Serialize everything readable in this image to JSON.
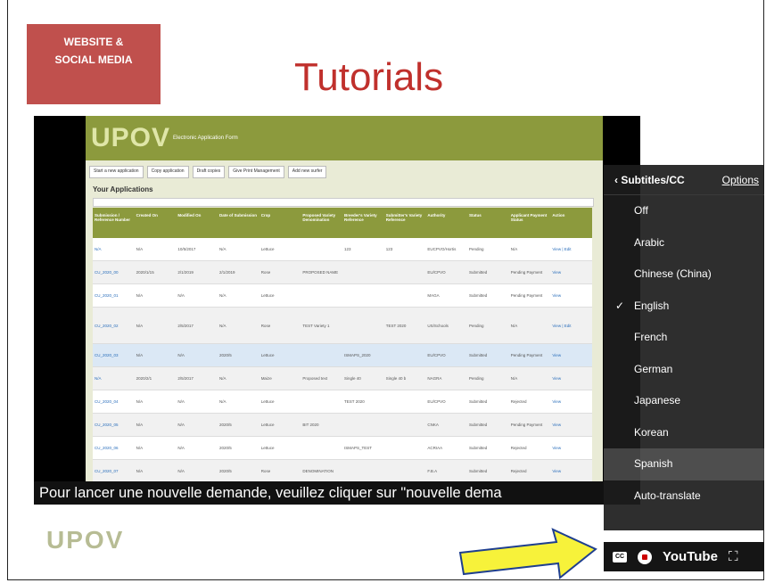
{
  "slide": {
    "badge_line1": "WEBSITE &",
    "badge_line2": "SOCIAL MEDIA",
    "title": "Tutorials",
    "footer_logo": "UPOV"
  },
  "video": {
    "app": {
      "logo": "UPOV",
      "subtitle": "Electronic Application Form",
      "toolbar": [
        "Start a new application",
        "Copy application",
        "Draft copies",
        "Give Print Management",
        "Add new surfer"
      ],
      "section_title": "Your Applications",
      "columns": [
        "Submission / Reference Number",
        "Created On",
        "Modified On",
        "Date of Submission",
        "Crop",
        "Proposed Variety Denomination",
        "Breeder's Variety Reference",
        "Submitter's Variety Reference",
        "Authority",
        "Status",
        "Applicant Payment Status",
        "Action"
      ],
      "rows": [
        [
          "N/A",
          "N/A",
          "10/5/2017",
          "N/A",
          "Lettuce",
          "",
          "123",
          "123",
          "EUCPVO/Hortis",
          "Pending",
          "N/A",
          "View | Edit"
        ],
        [
          "CU_2020_00",
          "2020/1/15",
          "2/1/2019",
          "2/1/2019",
          "Rose",
          "PROPOSED NAME",
          "",
          "",
          "EU/CPVO",
          "Submitted",
          "Pending Payment",
          "View"
        ],
        [
          "CU_2020_01",
          "N/A",
          "N/A",
          "N/A",
          "Lettuce",
          "",
          "",
          "",
          "MAGA",
          "Submitted",
          "Pending Payment",
          "View"
        ],
        [
          "CU_2020_02",
          "N/A",
          "2/5/2017",
          "N/A",
          "Rose",
          "TEST Variety 1",
          "",
          "TEST 2020",
          "US/Schools",
          "Pending",
          "N/A",
          "View | Edit"
        ],
        [
          "CU_2020_03",
          "N/A",
          "N/A",
          "2020/5",
          "Lettuce",
          "",
          "ISMAPS_2020",
          "",
          "EU/CPVO",
          "Submitted",
          "Pending Payment",
          "View"
        ],
        [
          "N/A",
          "2020/2/1",
          "2/5/2017",
          "N/A",
          "Maize",
          "Proposed text",
          "Single 40",
          "Single 40 b",
          "NAGRA",
          "Pending",
          "N/A",
          "View"
        ],
        [
          "CU_2020_04",
          "N/A",
          "N/A",
          "N/A",
          "Lettuce",
          "",
          "TEST 2020",
          "",
          "EU/CPVO",
          "Submitted",
          "Rejected",
          "View"
        ],
        [
          "CU_2020_05",
          "N/A",
          "N/A",
          "2020/5",
          "Lettuce",
          "BIT 2020",
          "",
          "",
          "CNKA",
          "Submitted",
          "Pending Payment",
          "View"
        ],
        [
          "CU_2020_06",
          "N/A",
          "N/A",
          "2020/5",
          "Lettuce",
          "",
          "ISMAPS_TEST",
          "",
          "ACRIAA",
          "Submitted",
          "Rejected",
          "View"
        ],
        [
          "CU_2020_07",
          "N/A",
          "N/A",
          "2020/5",
          "Rose",
          "DENOMINATION",
          "",
          "",
          "F.B.A",
          "Submitted",
          "Rejected",
          "View"
        ]
      ]
    },
    "caption": "Pour lancer une nouvelle demande, veuillez cliquer sur \"nouvelle dema"
  },
  "subtitles_menu": {
    "header": "Subtitles/CC",
    "options_link": "Options",
    "back_glyph": "‹",
    "check_glyph": "✓",
    "selected": "English",
    "items": [
      "Off",
      "Arabic",
      "Chinese (China)",
      "English",
      "French",
      "German",
      "Japanese",
      "Korean",
      "Spanish",
      "Auto-translate"
    ]
  },
  "player_bar": {
    "cc_label": "CC",
    "youtube_label": "YouTube",
    "fullscreen_glyph": "⛶"
  },
  "colors": {
    "badge": "#c0504d",
    "title": "#c0302c",
    "upov_green": "#8c9a3d",
    "arrow_fill": "#f7f23a"
  }
}
